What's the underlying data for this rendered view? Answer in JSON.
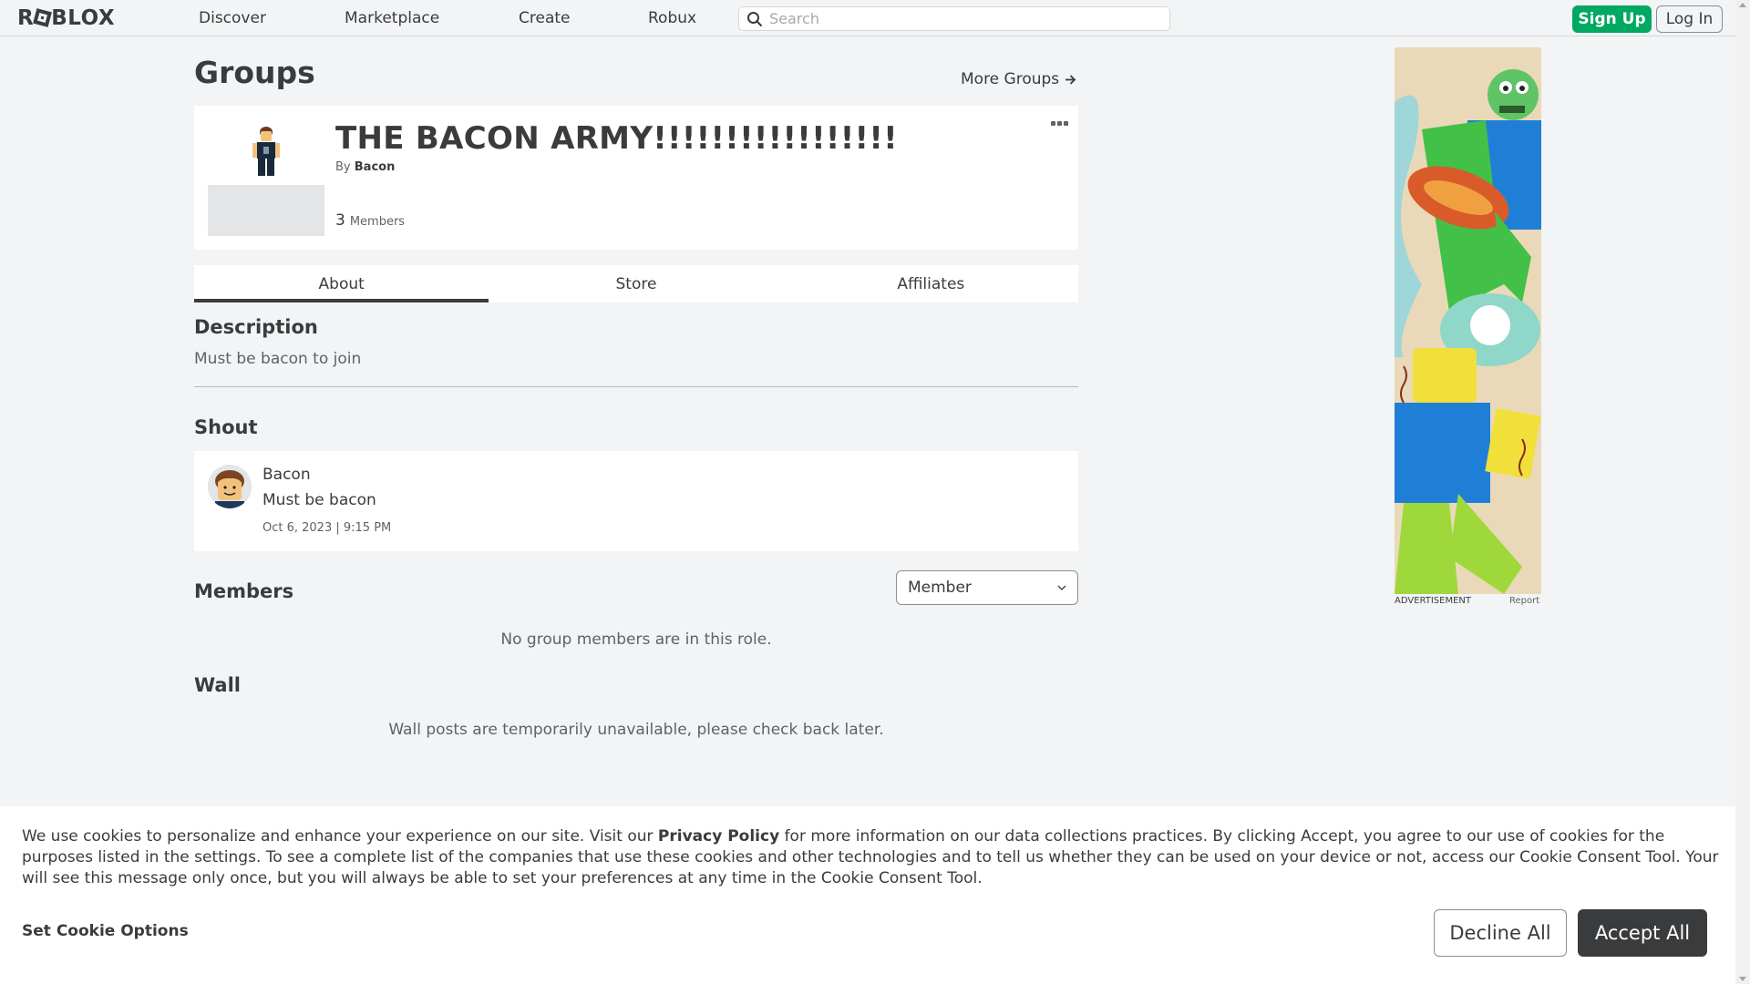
{
  "nav": {
    "logo": "ROBLOX",
    "links": [
      "Discover",
      "Marketplace",
      "Create",
      "Robux"
    ],
    "search_placeholder": "Search",
    "signup": "Sign Up",
    "login": "Log In"
  },
  "page": {
    "title": "Groups",
    "more_groups": "More Groups"
  },
  "group": {
    "name": "THE BACON ARMY!!!!!!!!!!!!!!!!!",
    "by_label": "By",
    "owner": "Bacon",
    "member_count": "3",
    "members_label": "Members"
  },
  "tabs": [
    "About",
    "Store",
    "Affiliates"
  ],
  "description": {
    "heading": "Description",
    "text": "Must be bacon to join"
  },
  "shout": {
    "heading": "Shout",
    "author": "Bacon",
    "body": "Must be bacon",
    "date": "Oct 6, 2023 | 9:15 PM"
  },
  "members": {
    "heading": "Members",
    "role": "Member",
    "empty": "No group members are in this role."
  },
  "wall": {
    "heading": "Wall",
    "message": "Wall posts are temporarily unavailable, please check back later."
  },
  "ad": {
    "label": "ADVERTISEMENT",
    "report": "Report"
  },
  "cookie": {
    "text_before": "We use cookies to personalize and enhance your experience on our site. Visit our ",
    "privacy_link": "Privacy Policy",
    "text_after": " for more information on our data collections practices. By clicking Accept, you agree to our use of cookies for the purposes listed in the settings. To see a complete list of the companies that use these cookies and other technologies and to tell us whether they can be used on your device or not, access our Cookie Consent Tool. Your will see this message only once, but you will always be able to set your preferences at any time in the Cookie Consent Tool.",
    "set_options": "Set Cookie Options",
    "decline": "Decline All",
    "accept": "Accept All"
  },
  "colors": {
    "accent_green": "#00a862",
    "text_dark": "#393b3d",
    "background": "#f2f4f5"
  }
}
